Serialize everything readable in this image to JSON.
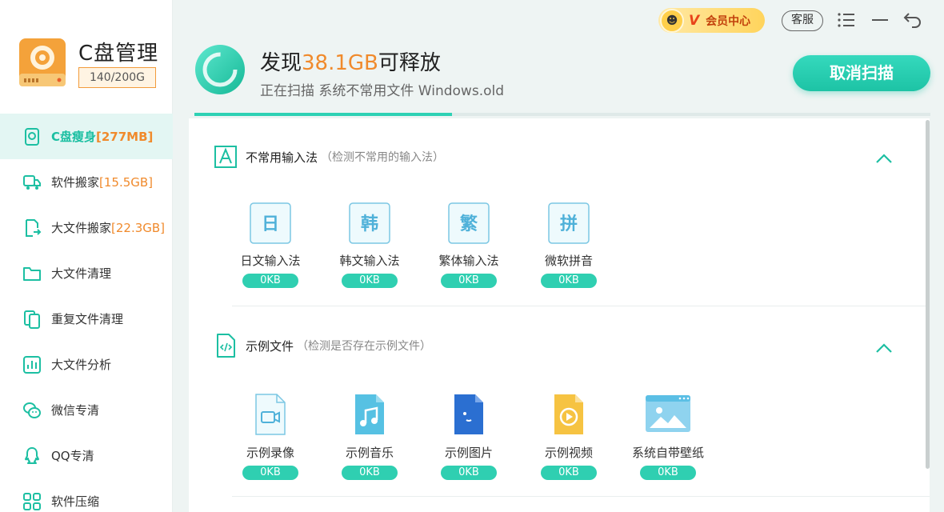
{
  "brand": {
    "title": "C盘管理",
    "capacity": "140/200G"
  },
  "sidebar": {
    "items": [
      {
        "label": "C盘瘦身",
        "suffix": "[277MB]",
        "icon": "phone-clean-icon",
        "active": true
      },
      {
        "label": "软件搬家",
        "suffix": "[15.5GB]",
        "icon": "truck-icon"
      },
      {
        "label": "大文件搬家",
        "suffix": "[22.3GB]",
        "icon": "file-move-icon"
      },
      {
        "label": "大文件清理",
        "suffix": "",
        "icon": "folder-icon"
      },
      {
        "label": "重复文件清理",
        "suffix": "",
        "icon": "duplicate-file-icon"
      },
      {
        "label": "大文件分析",
        "suffix": "",
        "icon": "bar-chart-icon"
      },
      {
        "label": "微信专清",
        "suffix": "",
        "icon": "wechat-icon"
      },
      {
        "label": "QQ专清",
        "suffix": "",
        "icon": "qq-icon"
      },
      {
        "label": "软件压缩",
        "suffix": "",
        "icon": "grid-icon"
      }
    ]
  },
  "topbar": {
    "vip_mark": "V",
    "vip_label": "会员中心",
    "service_label": "客服",
    "menu_icon": "menu-icon",
    "minimize_icon": "minimize-icon",
    "back_icon": "undo-icon"
  },
  "scan": {
    "title_prefix": "发现",
    "amount": "38.1GB",
    "title_suffix": "可释放",
    "status": "正在扫描 系统不常用文件 Windows.old",
    "progress": 0.35,
    "cancel_label": "取消扫描"
  },
  "sections": [
    {
      "title": "不常用输入法",
      "desc": "（检测不常用的输入法）",
      "icon": "letter-a-icon",
      "items": [
        {
          "glyph": "日",
          "label": "日文输入法",
          "size": "0KB"
        },
        {
          "glyph": "韩",
          "label": "韩文输入法",
          "size": "0KB"
        },
        {
          "glyph": "繁",
          "label": "繁体输入法",
          "size": "0KB"
        },
        {
          "glyph": "拼",
          "label": "微软拼音",
          "size": "0KB"
        }
      ]
    },
    {
      "title": "示例文件",
      "desc": "（检测是否存在示例文件）",
      "icon": "code-file-icon",
      "items": [
        {
          "label": "示例录像",
          "size": "0KB",
          "icon": "video-file-icon"
        },
        {
          "label": "示例音乐",
          "size": "0KB",
          "icon": "music-file-icon"
        },
        {
          "label": "示例图片",
          "size": "0KB",
          "icon": "image-file-icon"
        },
        {
          "label": "示例视频",
          "size": "0KB",
          "icon": "play-file-icon"
        },
        {
          "label": "系统自带壁纸",
          "size": "0KB",
          "icon": "wallpaper-icon"
        }
      ]
    }
  ],
  "colors": {
    "accent": "#2fcfb1",
    "orange": "#f08a2c"
  }
}
